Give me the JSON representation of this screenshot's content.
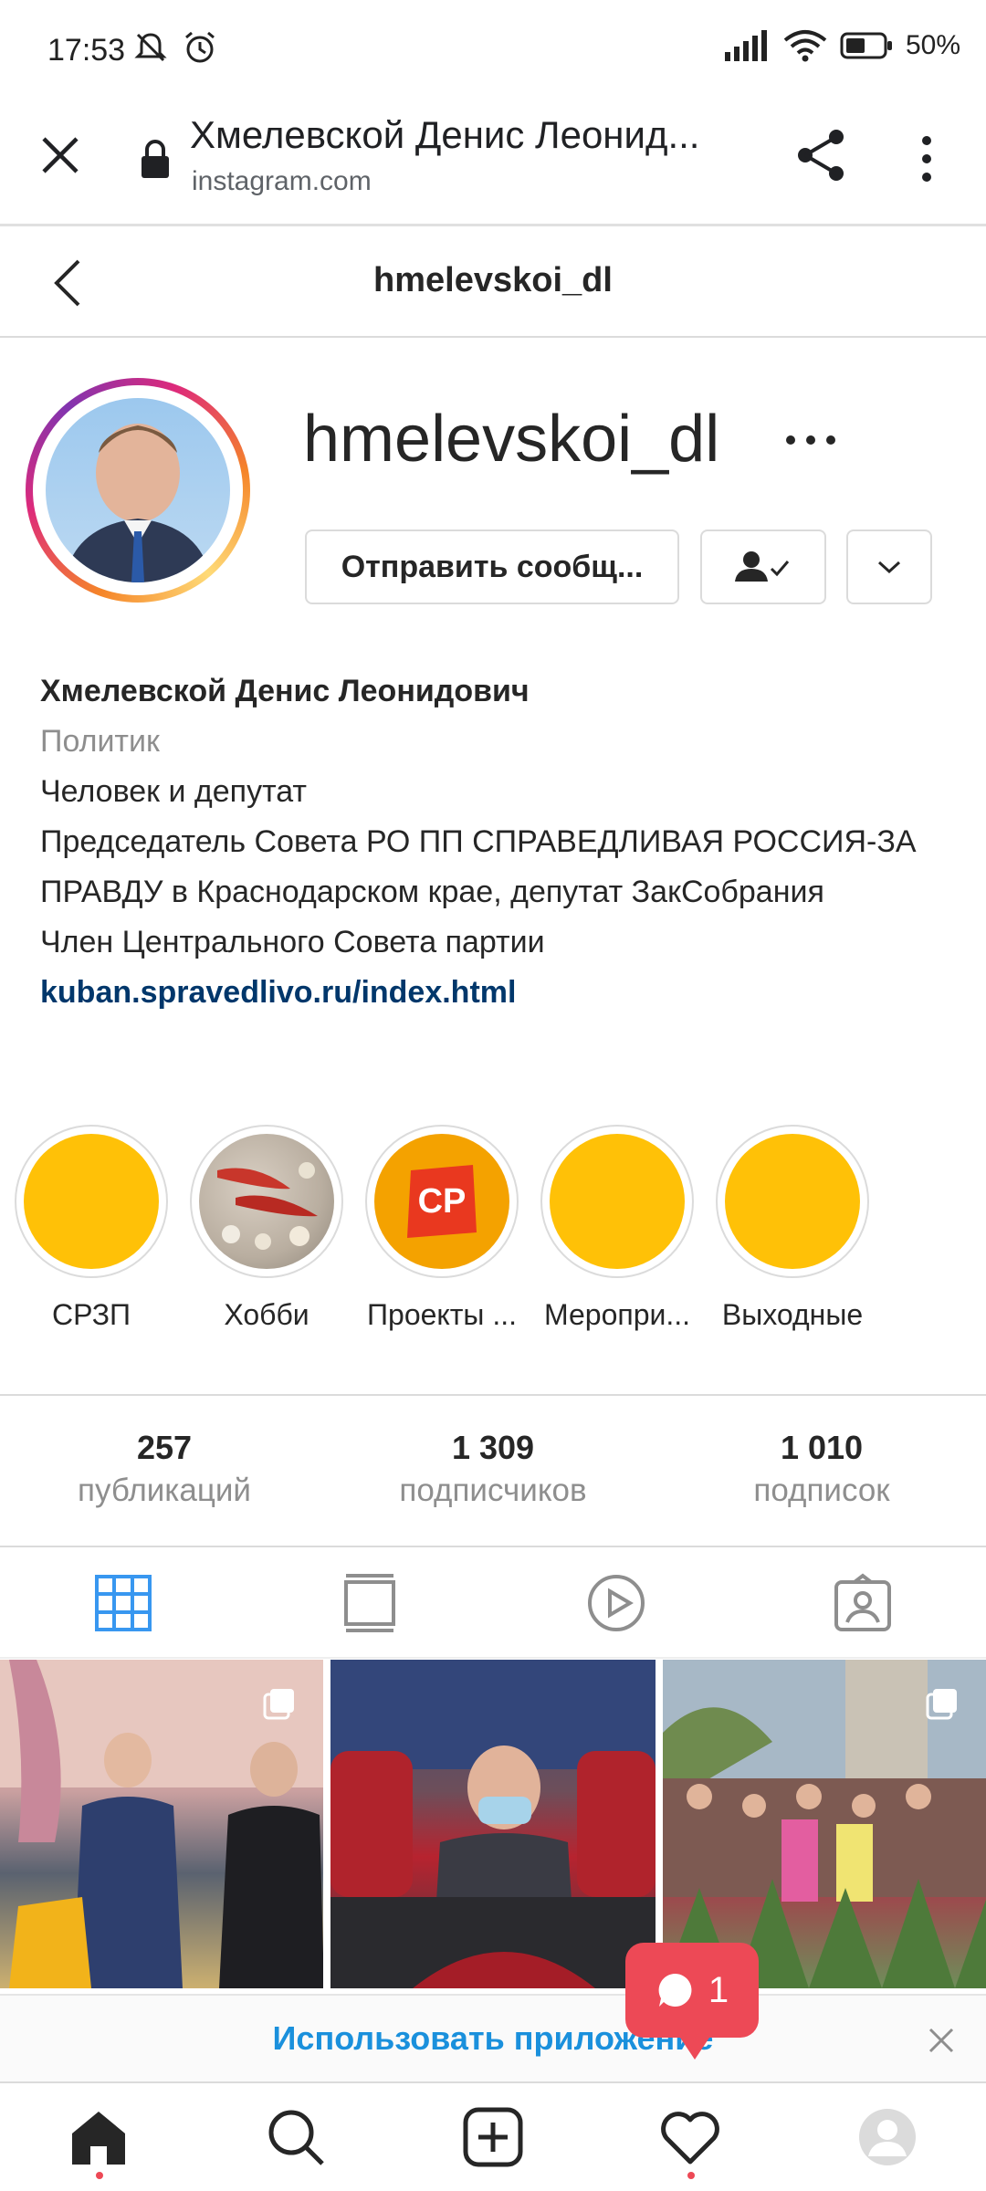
{
  "status_bar": {
    "time": "17:53",
    "battery": "50%",
    "icons": [
      "mute-icon",
      "alarm-icon",
      "signal-icon",
      "wifi-icon",
      "battery-icon"
    ]
  },
  "browser": {
    "page_title": "Хмелевской Денис Леонид...",
    "domain": "instagram.com"
  },
  "header": {
    "title": "hmelevskoi_dl"
  },
  "profile": {
    "username": "hmelevskoi_dl",
    "message_button": "Отправить сообщ...",
    "bio": {
      "name": "Хмелевской Денис Леонидович",
      "category": "Политик",
      "line1": "Человек и депутат",
      "line2": "Председатель Совета РО ПП СПРАВЕДЛИВАЯ РОССИЯ-ЗА ПРАВДУ в Краснодарском крае, депутат ЗакСобрания",
      "line3": "Член Центрального Совета партии",
      "link": "kuban.spravedlivo.ru/index.html"
    }
  },
  "highlights": [
    {
      "label": "СРЗП"
    },
    {
      "label": "Хобби"
    },
    {
      "label": "Проекты ..."
    },
    {
      "label": "Меропри..."
    },
    {
      "label": "Выходные"
    }
  ],
  "highlight_logo_text": "СР",
  "stats": [
    {
      "value": "257",
      "label": "публикаций"
    },
    {
      "value": "1 309",
      "label": "подписчиков"
    },
    {
      "value": "1 010",
      "label": "подписок"
    }
  ],
  "app_banner": {
    "text": "Использовать приложение"
  },
  "notification": {
    "count": "1"
  },
  "colors": {
    "accent_red": "#ed4956",
    "link_blue": "#00376b",
    "banner_blue": "#1a90dc",
    "highlight_yellow": "#ffc107"
  }
}
